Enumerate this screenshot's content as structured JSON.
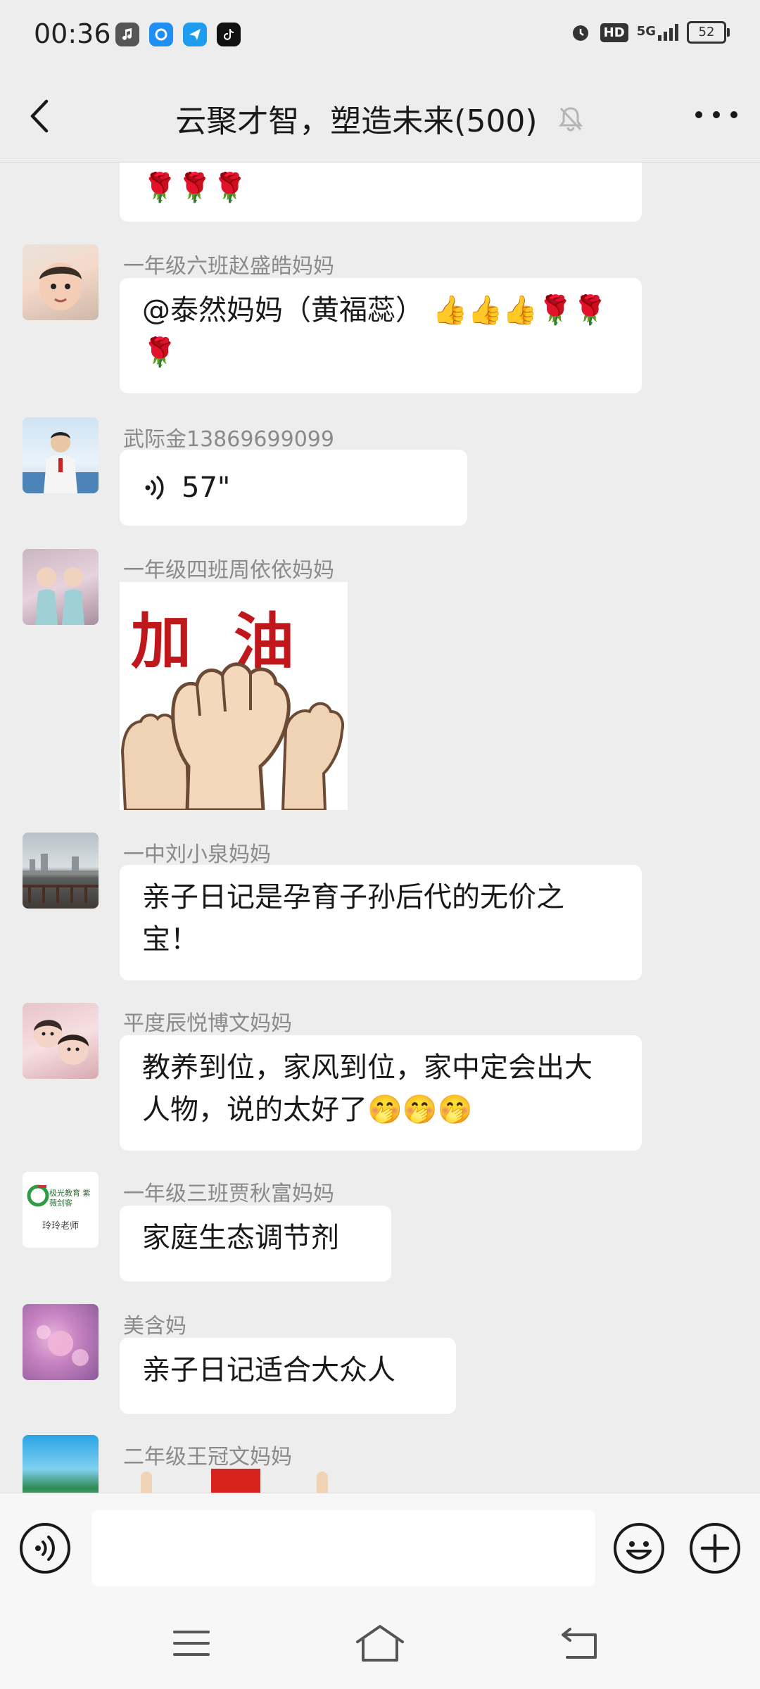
{
  "status_bar": {
    "time": "00:36",
    "network": "5G",
    "hd_label": "HD",
    "battery": "52"
  },
  "header": {
    "title": "云聚才智，塑造未来(500)"
  },
  "messages": [
    {
      "id": "m0",
      "name": "",
      "text": "🌹🌹🌹",
      "type": "text"
    },
    {
      "id": "m1",
      "name": "一年级六班赵盛皓妈妈",
      "text": "@泰然妈妈（黄福蕊） 👍👍👍🌹🌹🌹",
      "type": "text"
    },
    {
      "id": "m2",
      "name": "武际金13869699099",
      "voice_duration": "57\"",
      "type": "voice"
    },
    {
      "id": "m3",
      "name": "一年级四班周依依妈妈",
      "sticker_text": "加油",
      "type": "sticker"
    },
    {
      "id": "m4",
      "name": "一中刘小泉妈妈",
      "text": "亲子日记是孕育子孙后代的无价之宝！",
      "type": "text"
    },
    {
      "id": "m5",
      "name": "平度辰悦博文妈妈",
      "text": "教养到位，家风到位，家中定会出大人物，说的太好了🤭🤭🤭",
      "type": "text"
    },
    {
      "id": "m6",
      "name": "一年级三班贾秋富妈妈",
      "text": "家庭生态调节剂",
      "avatar_text": "玲玲老师",
      "avatar_logo": "极光教育 紫薇剑客",
      "type": "text"
    },
    {
      "id": "m7",
      "name": "美含妈",
      "text": "亲子日记适合大众人",
      "type": "text"
    },
    {
      "id": "m8",
      "name": "二年级王冠文妈妈",
      "type": "sticker"
    }
  ],
  "input_bar": {
    "voice_icon": "voice-icon",
    "emoji_icon": "emoji-icon",
    "plus_icon": "plus-icon",
    "placeholder": ""
  },
  "colors": {
    "background": "#ededed",
    "bubble": "#ffffff",
    "name_gray": "#8a8a8a",
    "sticker_red": "#c0171d"
  }
}
